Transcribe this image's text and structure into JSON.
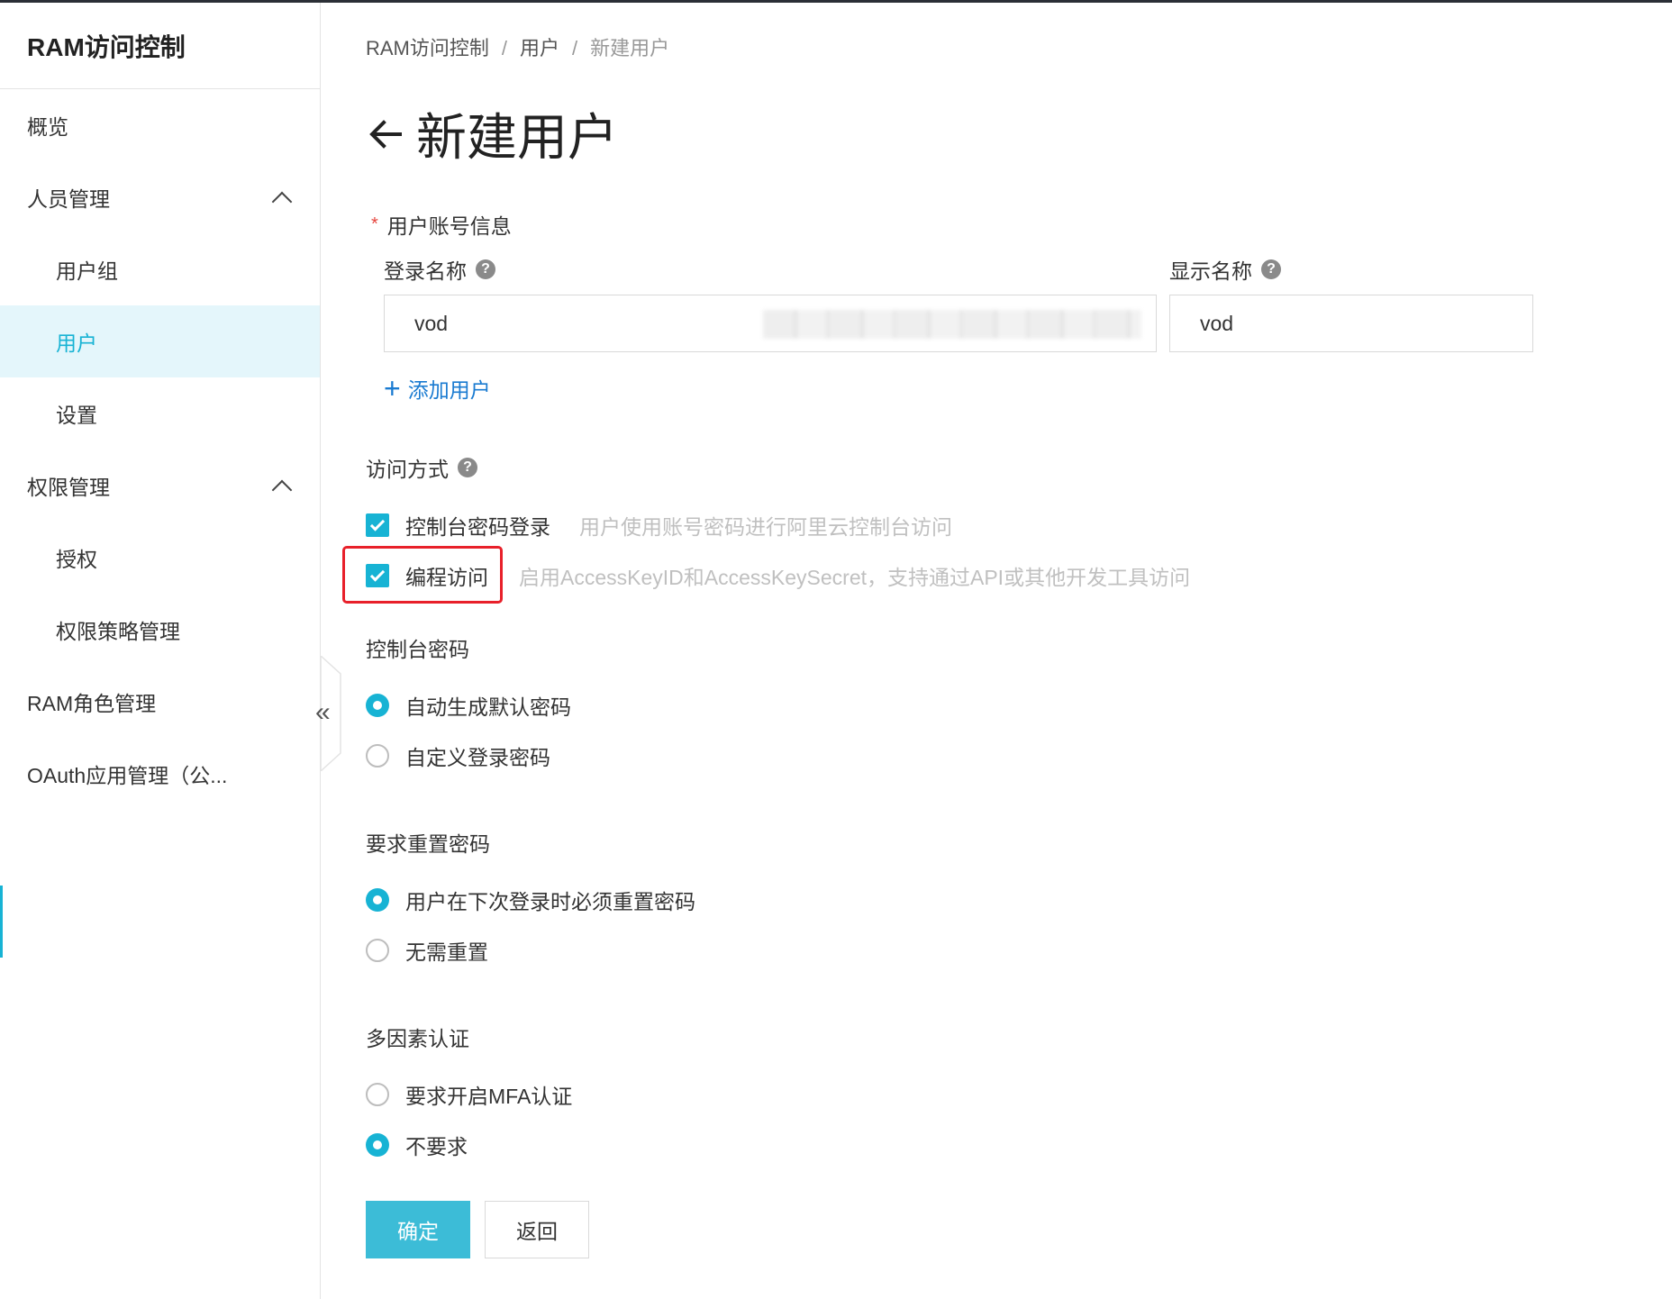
{
  "sidebar": {
    "title": "RAM访问控制",
    "items": [
      {
        "label": "概览"
      },
      {
        "label": "人员管理"
      },
      {
        "label": "用户组"
      },
      {
        "label": "用户"
      },
      {
        "label": "设置"
      },
      {
        "label": "权限管理"
      },
      {
        "label": "授权"
      },
      {
        "label": "权限策略管理"
      },
      {
        "label": "RAM角色管理"
      },
      {
        "label": "OAuth应用管理（公..."
      }
    ],
    "collapse_icon": "«"
  },
  "breadcrumb": {
    "items": [
      "RAM访问控制",
      "用户",
      "新建用户"
    ],
    "separator": "/"
  },
  "page": {
    "title": "新建用户"
  },
  "account_info": {
    "label": "用户账号信息",
    "login_name_label": "登录名称",
    "login_name_value": "vod",
    "display_name_label": "显示名称",
    "display_name_value": "vod",
    "help_glyph": "?",
    "add_user_label": "添加用户",
    "plus_glyph": "+"
  },
  "access_method": {
    "label": "访问方式",
    "console_login": {
      "label": "控制台密码登录",
      "hint": "用户使用账号密码进行阿里云控制台访问",
      "checked": true
    },
    "programmatic": {
      "label": "编程访问",
      "hint": "启用AccessKeyID和AccessKeySecret，支持通过API或其他开发工具访问",
      "checked": true
    }
  },
  "console_password": {
    "label": "控制台密码",
    "options": [
      "自动生成默认密码",
      "自定义登录密码"
    ],
    "selected": 0
  },
  "reset_password": {
    "label": "要求重置密码",
    "options": [
      "用户在下次登录时必须重置密码",
      "无需重置"
    ],
    "selected": 0
  },
  "mfa": {
    "label": "多因素认证",
    "options": [
      "要求开启MFA认证",
      "不要求"
    ],
    "selected": 1
  },
  "actions": {
    "confirm": "确定",
    "back": "返回"
  },
  "colors": {
    "accent": "#17b3d4",
    "link": "#1a7bd1",
    "highlight": "#e8202a",
    "required": "#e6463f"
  }
}
